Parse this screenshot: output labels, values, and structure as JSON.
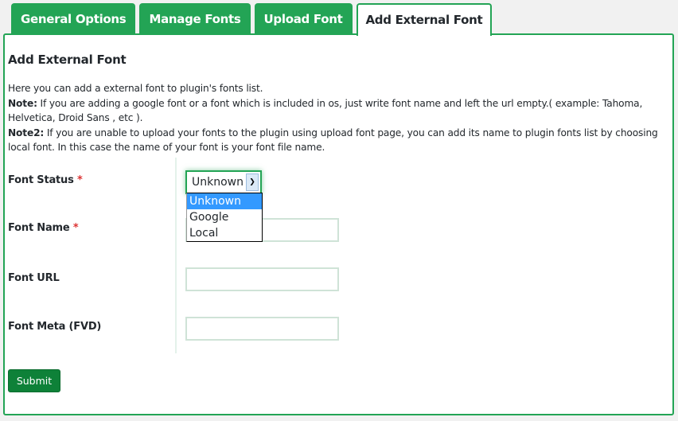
{
  "tabs": [
    {
      "label": "General Options",
      "active": false
    },
    {
      "label": "Manage Fonts",
      "active": false
    },
    {
      "label": "Upload Font",
      "active": false
    },
    {
      "label": "Add External Font",
      "active": true
    }
  ],
  "panel": {
    "title": "Add External Font",
    "description": {
      "intro": "Here you can add a external font to plugin's fonts list.",
      "note_label": "Note:",
      "note_text": " If you are adding a google font or a font which is included in os, just write font name and left the url empty.( example: Tahoma, Helvetica, Droid Sans , etc ).",
      "note2_label": "Note2:",
      "note2_text": " If you are unable to upload your fonts to the plugin using upload font page, you can add its name to plugin fonts list by choosing local font. In this case the name of your font is your font file name."
    }
  },
  "form": {
    "required_marker": "*",
    "font_status": {
      "label": "Font Status",
      "required": true,
      "selected": "Unknown",
      "arrow_icon": "chevron-down-icon",
      "options": [
        "Unknown",
        "Google",
        "Local"
      ],
      "dropdown_open": true
    },
    "font_name": {
      "label": "Font Name",
      "required": true,
      "value": ""
    },
    "font_url": {
      "label": "Font URL",
      "required": false,
      "value": ""
    },
    "font_meta": {
      "label": "Font Meta (FVD)",
      "required": false,
      "value": ""
    },
    "submit_label": "Submit"
  },
  "colors": {
    "accent": "#23a455",
    "submit": "#0e8138",
    "required": "#dd3333",
    "selected_option": "#3399ff"
  }
}
